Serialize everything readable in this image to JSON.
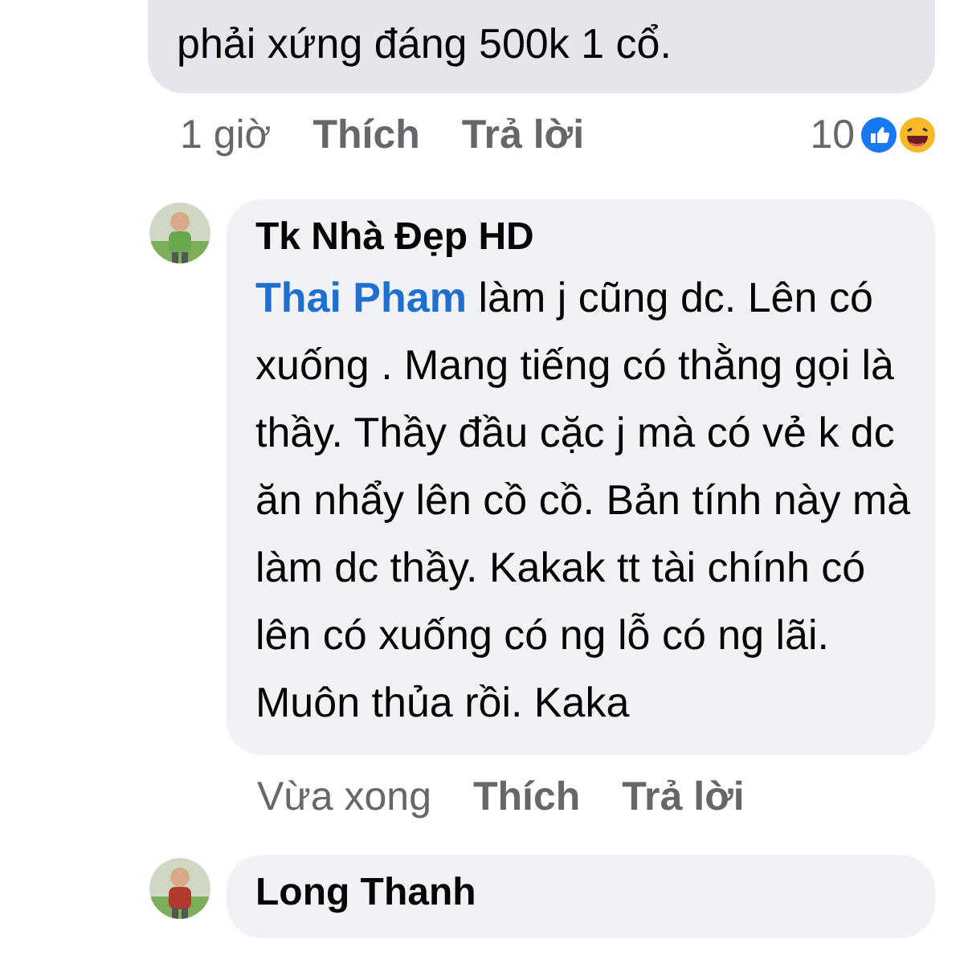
{
  "comments": [
    {
      "kind": "continued",
      "text": "phải xứng đáng 500k 1 cổ.",
      "time": "1 giờ",
      "like": "Thích",
      "reply": "Trả lời",
      "reaction_count": "10"
    },
    {
      "kind": "full",
      "author": "Tk Nhà Đẹp HD",
      "mention": "Thai Pham",
      "text": "làm j cũng dc. Lên có xuống . Mang tiếng có thằng gọi là thầy. Thầy đầu cặc j mà có vẻ k dc ăn nhẩy lên cồ cồ. Bản tính này mà làm dc thầy. Kakak tt tài chính có lên có xuống có ng lỗ có ng lãi. Muôn thủa rồi. Kaka",
      "time": "Vừa xong",
      "like": "Thích",
      "reply": "Trả lời"
    },
    {
      "kind": "header",
      "author": "Long Thanh"
    }
  ]
}
